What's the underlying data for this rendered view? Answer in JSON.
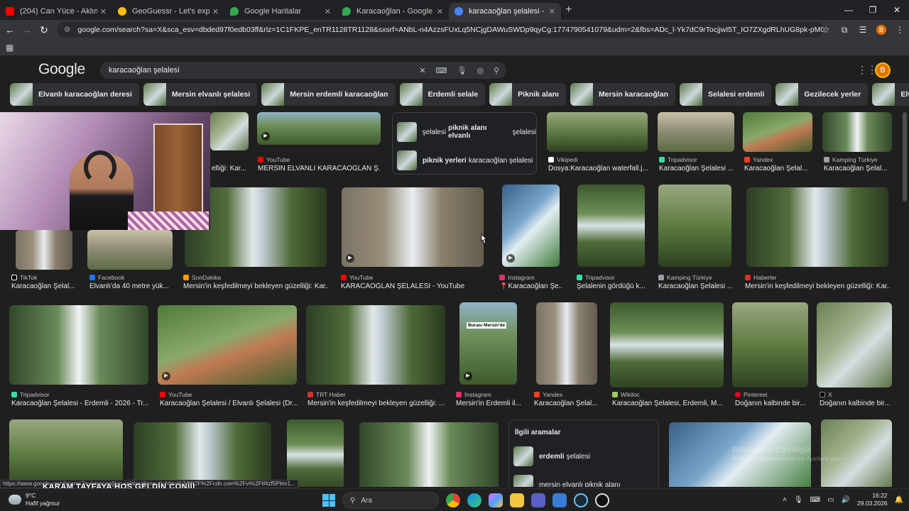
{
  "tabs": [
    {
      "title": "(204) Can Yüce - Aklım Gider A...",
      "color": "#ff0000"
    },
    {
      "title": "GeoGuessr - Let's explore the w...",
      "color": "#fbbc04"
    },
    {
      "title": "Google Haritalar",
      "color": "#34a853"
    },
    {
      "title": "Karacaoğlan - Google Haritalar",
      "color": "#34a853"
    },
    {
      "title": "karacaoğlan şelalesi - Google'd...",
      "color": "#4285f4"
    }
  ],
  "address": {
    "url": "google.com/search?sa=X&sca_esv=dbded97f0edb03ff&rlz=1C1FKPE_enTR1128TR1128&sxsrf=ANbL-n4AzzsFUxLq5NCjgDAWuSWDp9qyCg:1774790541079&udm=2&fbs=ADc_l-Yk7dC9rTocjjwI5T_IO7ZXgdRLhUG8pk-pM063RkPILQJoVswXu7Xoldd5...",
    "profile_initial": "B"
  },
  "google": {
    "logo": "Google",
    "query": "karacaoğlan şelalesi",
    "profile_initial": "B"
  },
  "chips": [
    "Elvanlı karacaoğlan deresi",
    "Mersin elvanlı şelalesi",
    "Mersin erdemli karacaoğlan",
    "Erdemli selale",
    "Piknik alanı",
    "Mersin karacaoğlan",
    "Selalesi erdemli",
    "Gezilecek yerler",
    "Elvanlı şelale"
  ],
  "row1": [
    {
      "source": "",
      "caption": "elliği: Kar..."
    },
    {
      "source": "YouTube",
      "caption": "MERSİN ELVANLI KARACAOĞLAN Ş..."
    },
    {
      "source": "Vikipedi",
      "caption": "Dosya:Karacaoğlan waterfall.j..."
    },
    {
      "source": "Tripadvisor",
      "caption": "Karacaoğlan Şelalesi ..."
    },
    {
      "source": "Yandex",
      "caption": "Karacaoğlan Şelal..."
    },
    {
      "source": "Kamping Türkiye",
      "caption": "Karacaoğlan Şelal..."
    }
  ],
  "suggest_popup": [
    {
      "pre": "şelalesi",
      "bold": "piknik alanı elvanlı",
      "post": "şelalesi"
    },
    {
      "pre": "",
      "bold": "piknik yerleri",
      "post": "karacaoğlan şelalesi"
    }
  ],
  "row2": [
    {
      "source": "TikTok",
      "caption": "Karacaoğlan Şelal..."
    },
    {
      "source": "Facebook",
      "caption": "Elvanlı'da 40 metre yük..."
    },
    {
      "source": "SonDakika",
      "caption": "Mersin'in keşfedilmeyi bekleyen güzelliği: Kar..."
    },
    {
      "source": "YouTube",
      "caption": "KARACAOĞLAN ŞELALESİ - YouTube"
    },
    {
      "source": "Instagram",
      "caption": "📍Karacaoğlan Şe..."
    },
    {
      "source": "Tripadvisor",
      "caption": "Şelalenin gördüğü k..."
    },
    {
      "source": "Kamping Türkiye",
      "caption": "Karacaoğlan Şelalesi ..."
    },
    {
      "source": "Haberler",
      "caption": "Mersin'in keşfedilmeyi bekleyen güzelliği: Kar..."
    }
  ],
  "row3": [
    {
      "source": "Tripadvisor",
      "caption": "Karacaoğlan Şelalesi - Erdemli - 2026 - Tr..."
    },
    {
      "source": "YouTube",
      "caption": "Karacaoğlan Şelalesi / Elvanlı Şelalesi (Dr..."
    },
    {
      "source": "TRT Haber",
      "caption": "Mersin'in keşfedilmeyi bekleyen güzelliği: ..."
    },
    {
      "source": "Instagram",
      "caption": "Mersin'in Erdemli il...",
      "overlay_text": "Burası Mersin'de"
    },
    {
      "source": "Yandex",
      "caption": "Karacaoğlan Şelal..."
    },
    {
      "source": "Wikiloc",
      "caption": "Karacaoğlan Şelalesi, Erdemli, M..."
    },
    {
      "source": "Pinterest",
      "caption": "Doğanın kalbinde bir..."
    },
    {
      "source": "X",
      "caption": "Doğanın kalbinde bir..."
    }
  ],
  "related": {
    "title": "İlgili aramalar",
    "items": [
      {
        "bold": "erdemli",
        "rest": "şelalesi"
      },
      {
        "bold": "",
        "rest": "mersin elvanlı piknik alanı"
      }
    ]
  },
  "watermark": {
    "line1": "Windows'u Etkinleştir",
    "line2": "Windows'u etkinleştirmek için Ayarlar'a gidin."
  },
  "status_url": "https://www.google.com/imgres?q=karacaoğlan şelalesi&imgurl=https%3A%2F%2Fcdn.com%2Fvi%2Ftf4zf5Plmr1...",
  "stream_overlay": "KARAM TAYFAYA HOŞ GELDİN CONİİİ",
  "taskbar": {
    "temp": "9°C",
    "weather": "Hafif yağmur",
    "search_placeholder": "Ara",
    "time": "16:22",
    "date": "29.03.2026"
  }
}
